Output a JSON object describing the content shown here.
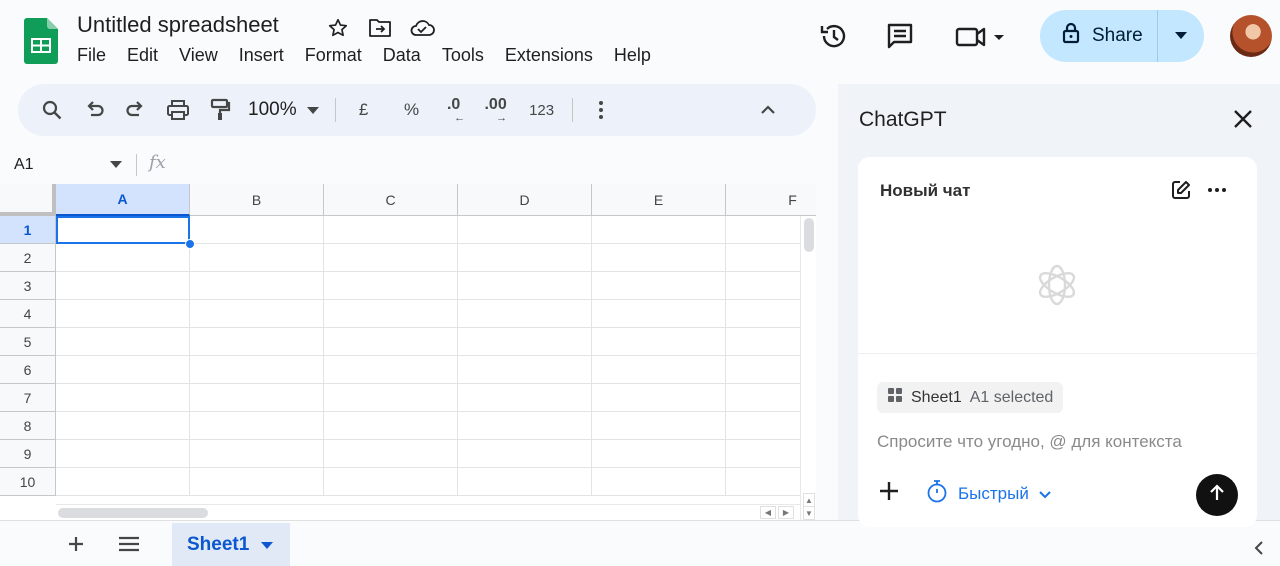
{
  "app": {
    "document_title": "Untitled spreadsheet",
    "menu": [
      "File",
      "Edit",
      "View",
      "Insert",
      "Format",
      "Data",
      "Tools",
      "Extensions",
      "Help"
    ],
    "share_label": "Share"
  },
  "toolbar": {
    "zoom": "100%",
    "currency": "£",
    "percent": "%",
    "decrease_decimal": ".0",
    "increase_decimal": ".00",
    "number_format": "123"
  },
  "formula_bar": {
    "name_box": "A1",
    "fx": "fx",
    "value": ""
  },
  "grid": {
    "columns": [
      "A",
      "B",
      "C",
      "D",
      "E",
      "F"
    ],
    "rows": [
      "1",
      "2",
      "3",
      "4",
      "5",
      "6",
      "7",
      "8",
      "9",
      "10"
    ],
    "selected_cell": "A1"
  },
  "sheets": {
    "tabs": [
      "Sheet1"
    ]
  },
  "panel": {
    "title": "ChatGPT",
    "chat_title": "Новый чат",
    "context_chip_sheet": "Sheet1",
    "context_chip_selection": "A1 selected",
    "prompt_placeholder": "Спросите что угодно, @ для контекста",
    "mode_label": "Быстрый"
  },
  "colors": {
    "accent": "#0b57d0",
    "share_bg": "#c2e7ff",
    "sheets_green": "#0f9d58",
    "selection": "#1a73e8"
  },
  "icons": [
    "sheets-logo-icon",
    "star-icon",
    "move-folder-icon",
    "cloud-status-icon",
    "history-icon",
    "comments-icon",
    "meet-icon",
    "lock-icon",
    "search-icon",
    "undo-icon",
    "redo-icon",
    "print-icon",
    "paint-format-icon",
    "more-vert-icon",
    "chevron-up-icon",
    "add-sheet-icon",
    "all-sheets-icon",
    "close-icon",
    "new-chat-icon",
    "more-horiz-icon",
    "openai-logo-icon",
    "plus-icon",
    "timer-icon",
    "send-icon",
    "collapse-panel-icon"
  ]
}
